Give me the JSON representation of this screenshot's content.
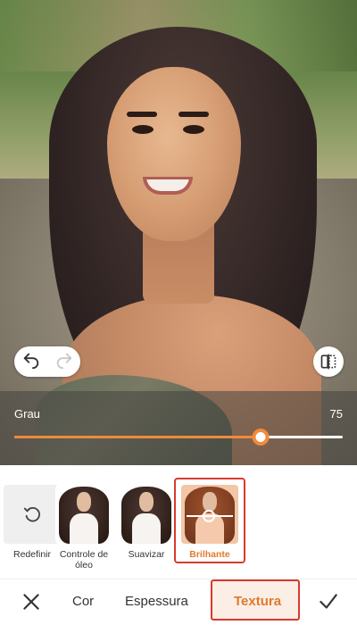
{
  "editor": {
    "slider": {
      "label": "Grau",
      "value": "75",
      "fraction": 0.75
    },
    "presets": [
      {
        "label": "Redefinir",
        "icon": "reset-icon"
      },
      {
        "label": "Controle de óleo"
      },
      {
        "label": "Suavizar"
      },
      {
        "label": "Brilhante",
        "selected": true
      }
    ],
    "tabs": [
      {
        "label": "Cor"
      },
      {
        "label": "Espessura"
      },
      {
        "label": "Textura",
        "active": true
      }
    ],
    "colors": {
      "accent": "#f08a3c",
      "selected_outline": "#d83a2e",
      "active_text": "#e07a2c"
    }
  }
}
